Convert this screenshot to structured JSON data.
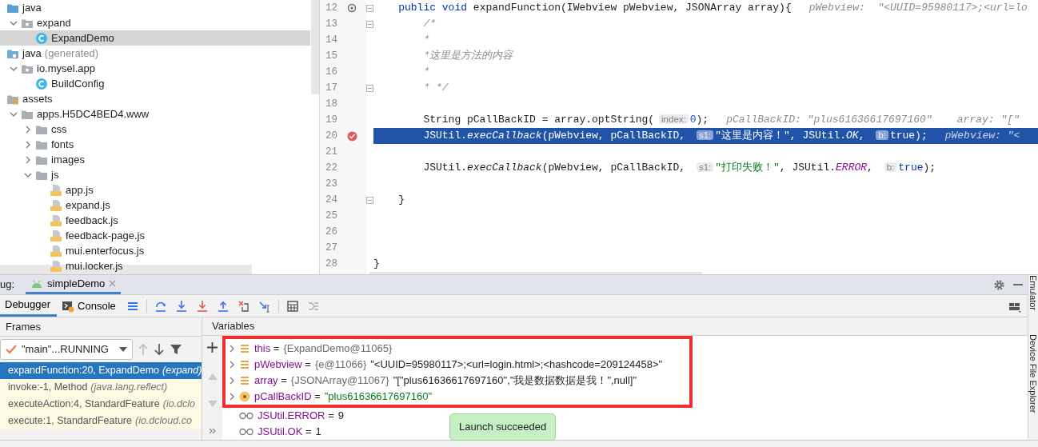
{
  "project_tree": [
    {
      "name": "java",
      "kind": "source-folder",
      "selected": false,
      "children": [
        {
          "name": "expand",
          "kind": "package",
          "expanded": true,
          "selected": false,
          "children": [
            {
              "name": "ExpandDemo",
              "kind": "class",
              "selected": true
            }
          ]
        }
      ]
    },
    {
      "name": "java",
      "note": "(generated)",
      "kind": "generated-folder",
      "selected": false,
      "children": [
        {
          "name": "io.mysel.app",
          "kind": "package",
          "expanded": true,
          "selected": false,
          "children": [
            {
              "name": "BuildConfig",
              "kind": "class",
              "selected": false
            }
          ]
        }
      ]
    },
    {
      "name": "assets",
      "kind": "assets-folder",
      "selected": false,
      "children": [
        {
          "name": "apps.H5DC4BED4.www",
          "kind": "folder",
          "expanded": true,
          "selected": false,
          "children": [
            {
              "name": "css",
              "kind": "folder",
              "expanded": false,
              "selected": false
            },
            {
              "name": "fonts",
              "kind": "folder",
              "expanded": false,
              "selected": false
            },
            {
              "name": "images",
              "kind": "folder",
              "expanded": false,
              "selected": false
            },
            {
              "name": "js",
              "kind": "folder",
              "expanded": true,
              "selected": false,
              "children": [
                {
                  "name": "app.js",
                  "kind": "js",
                  "selected": false
                },
                {
                  "name": "expand.js",
                  "kind": "js",
                  "selected": false
                },
                {
                  "name": "feedback.js",
                  "kind": "js",
                  "selected": false
                },
                {
                  "name": "feedback-page.js",
                  "kind": "js",
                  "selected": false
                },
                {
                  "name": "mui.enterfocus.js",
                  "kind": "js",
                  "selected": false
                },
                {
                  "name": "mui.locker.js",
                  "kind": "js",
                  "selected": false
                }
              ]
            }
          ]
        }
      ]
    }
  ],
  "editor": {
    "lines": [
      {
        "number": "12",
        "override": true,
        "fold": true,
        "current": false,
        "segments": [
          {
            "kind": "keyword",
            "text": "    public void "
          },
          {
            "kind": "plain",
            "text": "expandFunction(IWebview pWebview, JSONArray array){"
          }
        ],
        "inline": "pWebview:  \"<UUID=95980117>;<url=lo"
      },
      {
        "number": "13",
        "fold": true,
        "current": false,
        "segments": [
          {
            "kind": "comment",
            "text": "        /*"
          }
        ]
      },
      {
        "number": "14",
        "current": false,
        "segments": [
          {
            "kind": "comment",
            "text": "        *"
          }
        ]
      },
      {
        "number": "15",
        "current": false,
        "segments": [
          {
            "kind": "comment",
            "text": "        *这里是方法的内容"
          }
        ]
      },
      {
        "number": "16",
        "current": false,
        "segments": [
          {
            "kind": "comment",
            "text": "        *"
          }
        ]
      },
      {
        "number": "17",
        "fold": true,
        "current": false,
        "segments": [
          {
            "kind": "comment",
            "text": "        * */"
          }
        ]
      },
      {
        "number": "18",
        "current": false
      },
      {
        "number": "19",
        "current": false,
        "segments": [
          {
            "kind": "plain",
            "text": "        String pCallBackID = array.optString("
          },
          {
            "kind": "hint",
            "text": "index:"
          },
          {
            "kind": "number",
            "text": "0"
          },
          {
            "kind": "plain",
            "text": ");"
          }
        ],
        "inline": "pCallBackID: \"plus61636617697160\"    array: \"[\""
      },
      {
        "number": "20",
        "breakpoint": true,
        "current": true,
        "segments": [
          {
            "kind": "plain",
            "text": "        JSUtil."
          },
          {
            "kind": "static",
            "text": "execCallback"
          },
          {
            "kind": "plain",
            "text": "(pWebview, pCallBackID, "
          },
          {
            "kind": "hint",
            "text": "s1:"
          },
          {
            "kind": "string",
            "text": "\"这里是内容！\""
          },
          {
            "kind": "plain",
            "text": ", JSUtil."
          },
          {
            "kind": "constant",
            "text": "OK"
          },
          {
            "kind": "plain",
            "text": ", "
          },
          {
            "kind": "hint",
            "text": "b:"
          },
          {
            "kind": "keyword",
            "text": "true"
          },
          {
            "kind": "plain",
            "text": ");"
          }
        ],
        "inline": "pWebview: \"<"
      },
      {
        "number": "21",
        "current": false
      },
      {
        "number": "22",
        "current": false,
        "segments": [
          {
            "kind": "plain",
            "text": "        JSUtil."
          },
          {
            "kind": "static",
            "text": "execCallback"
          },
          {
            "kind": "plain",
            "text": "(pWebview, pCallBackID, "
          },
          {
            "kind": "hint",
            "text": "s1:"
          },
          {
            "kind": "string",
            "text": "\"打印失败！\""
          },
          {
            "kind": "plain",
            "text": ", JSUtil."
          },
          {
            "kind": "constant",
            "text": "ERROR"
          },
          {
            "kind": "plain",
            "text": ", "
          },
          {
            "kind": "hint",
            "text": "b:"
          },
          {
            "kind": "keyword",
            "text": "true"
          },
          {
            "kind": "plain",
            "text": ");"
          }
        ]
      },
      {
        "number": "23",
        "current": false
      },
      {
        "number": "24",
        "fold": true,
        "current": false,
        "segments": [
          {
            "kind": "plain",
            "text": "    }"
          }
        ]
      },
      {
        "number": "25",
        "current": false
      },
      {
        "number": "26",
        "current": false
      },
      {
        "number": "27",
        "current": false
      },
      {
        "number": "28",
        "current": false,
        "segments": [
          {
            "kind": "plain",
            "text": "}"
          }
        ]
      }
    ]
  },
  "debug_panel": {
    "title_fragment": "ug:",
    "sessions": [
      {
        "label": "simpleDemo",
        "selected": true
      }
    ],
    "tabs": [
      {
        "label": "Debugger",
        "selected": true
      },
      {
        "label": "Console",
        "selected": false
      }
    ],
    "frames_title": "Frames",
    "variables_title": "Variables",
    "thread": "\"main\"...RUNNING",
    "frames": [
      {
        "method": "expandFunction:20, ExpandDemo",
        "package": "(expand)",
        "kind": "user",
        "selected": true
      },
      {
        "method": "invoke:-1, Method",
        "package": "(java.lang.reflect)",
        "kind": "library",
        "selected": false
      },
      {
        "method": "executeAction:4, StandardFeature",
        "package": "(io.dclo",
        "kind": "library",
        "selected": false
      },
      {
        "method": "execute:1, StandardFeature",
        "package": "(io.dcloud.co",
        "kind": "library",
        "selected": false
      }
    ],
    "variables": [
      {
        "name": "this",
        "operator": "=",
        "ref": "{ExpandDemo@11065}",
        "kind": "field",
        "expanded": false,
        "highlighted": true
      },
      {
        "name": "pWebview",
        "operator": "=",
        "ref": "{e@11066}",
        "value": "\"<UUID=95980117>;<url=login.html>;<hashcode=209124458>\"",
        "kind": "field",
        "expanded": false,
        "highlighted": true
      },
      {
        "name": "array",
        "operator": "=",
        "ref": "{JSONArray@11067}",
        "value": "\"[\"plus61636617697160\",\"我是数据数据是我！\",null]\"",
        "kind": "field",
        "expanded": false,
        "highlighted": true
      },
      {
        "name": "pCallBackID",
        "operator": "=",
        "value": "\"plus61636617697160\"",
        "kind": "param",
        "expanded": false,
        "highlighted": true
      },
      {
        "name": "JSUtil.ERROR",
        "operator": "=",
        "value": "9",
        "kind": "watch",
        "highlighted": false
      },
      {
        "name": "JSUtil.OK",
        "operator": "=",
        "value": "1",
        "kind": "watch",
        "highlighted": false
      }
    ],
    "toast": "Launch succeeded",
    "side_tools": [
      "Emulator",
      "Device File Explorer"
    ]
  }
}
